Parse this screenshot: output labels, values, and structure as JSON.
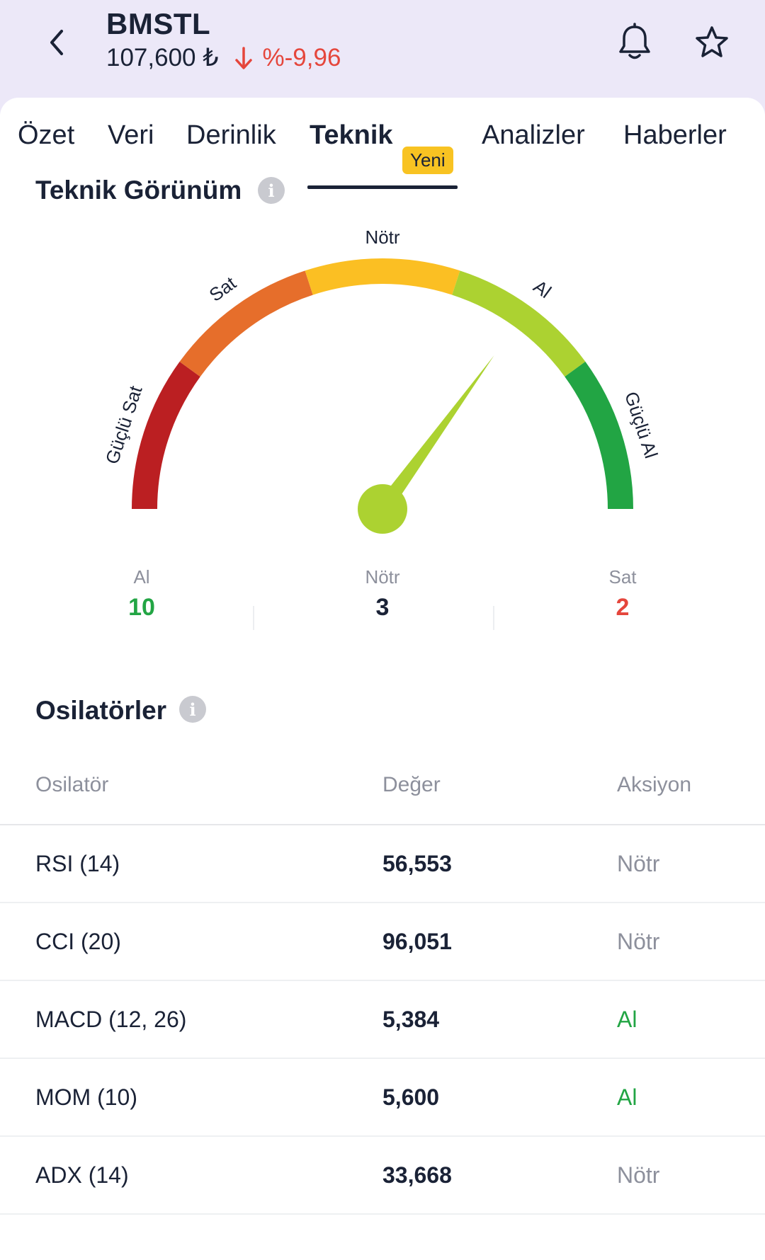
{
  "header": {
    "ticker": "BMSTL",
    "price": "107,600 ₺",
    "change": "%-9,96",
    "colors": {
      "down": "#e5463c"
    },
    "icons": {
      "back": "chevron-left-icon",
      "bell": "bell-icon",
      "star": "star-icon",
      "trend": "arrow-down-icon"
    }
  },
  "tabs": [
    {
      "label": "Özet",
      "active": false
    },
    {
      "label": "Veri",
      "active": false
    },
    {
      "label": "Derinlik",
      "active": false
    },
    {
      "label": "Teknik",
      "active": true,
      "badge": "Yeni"
    },
    {
      "label": "Analizler",
      "active": false
    },
    {
      "label": "Haberler",
      "active": false
    }
  ],
  "technical": {
    "title": "Teknik Görünüm",
    "gauge": {
      "segments": [
        {
          "label": "Güçlü Sat",
          "color": "#bb1f22"
        },
        {
          "label": "Sat",
          "color": "#e66e2b"
        },
        {
          "label": "Nötr",
          "color": "#fbbf23"
        },
        {
          "label": "Al",
          "color": "#acd231"
        },
        {
          "label": "Güçlü Al",
          "color": "#22a544"
        }
      ],
      "needle_value": 0.7,
      "needle_color": "#acd231"
    },
    "summary": [
      {
        "label": "Al",
        "value": "10",
        "color": "#22a544"
      },
      {
        "label": "Nötr",
        "value": "3",
        "color": "#1a2236"
      },
      {
        "label": "Sat",
        "value": "2",
        "color": "#e5463c"
      }
    ]
  },
  "oscillators": {
    "title": "Osilatörler",
    "columns": [
      "Osilatör",
      "Değer",
      "Aksiyon"
    ],
    "rows": [
      {
        "name": "RSI (14)",
        "value": "56,553",
        "action": "Nötr"
      },
      {
        "name": "CCI (20)",
        "value": "96,051",
        "action": "Nötr"
      },
      {
        "name": "MACD (12, 26)",
        "value": "5,384",
        "action": "Al"
      },
      {
        "name": "MOM (10)",
        "value": "5,600",
        "action": "Al"
      },
      {
        "name": "ADX (14)",
        "value": "33,668",
        "action": "Nötr"
      }
    ],
    "action_colors": {
      "Nötr": "#8d909c",
      "Al": "#22a544"
    }
  }
}
